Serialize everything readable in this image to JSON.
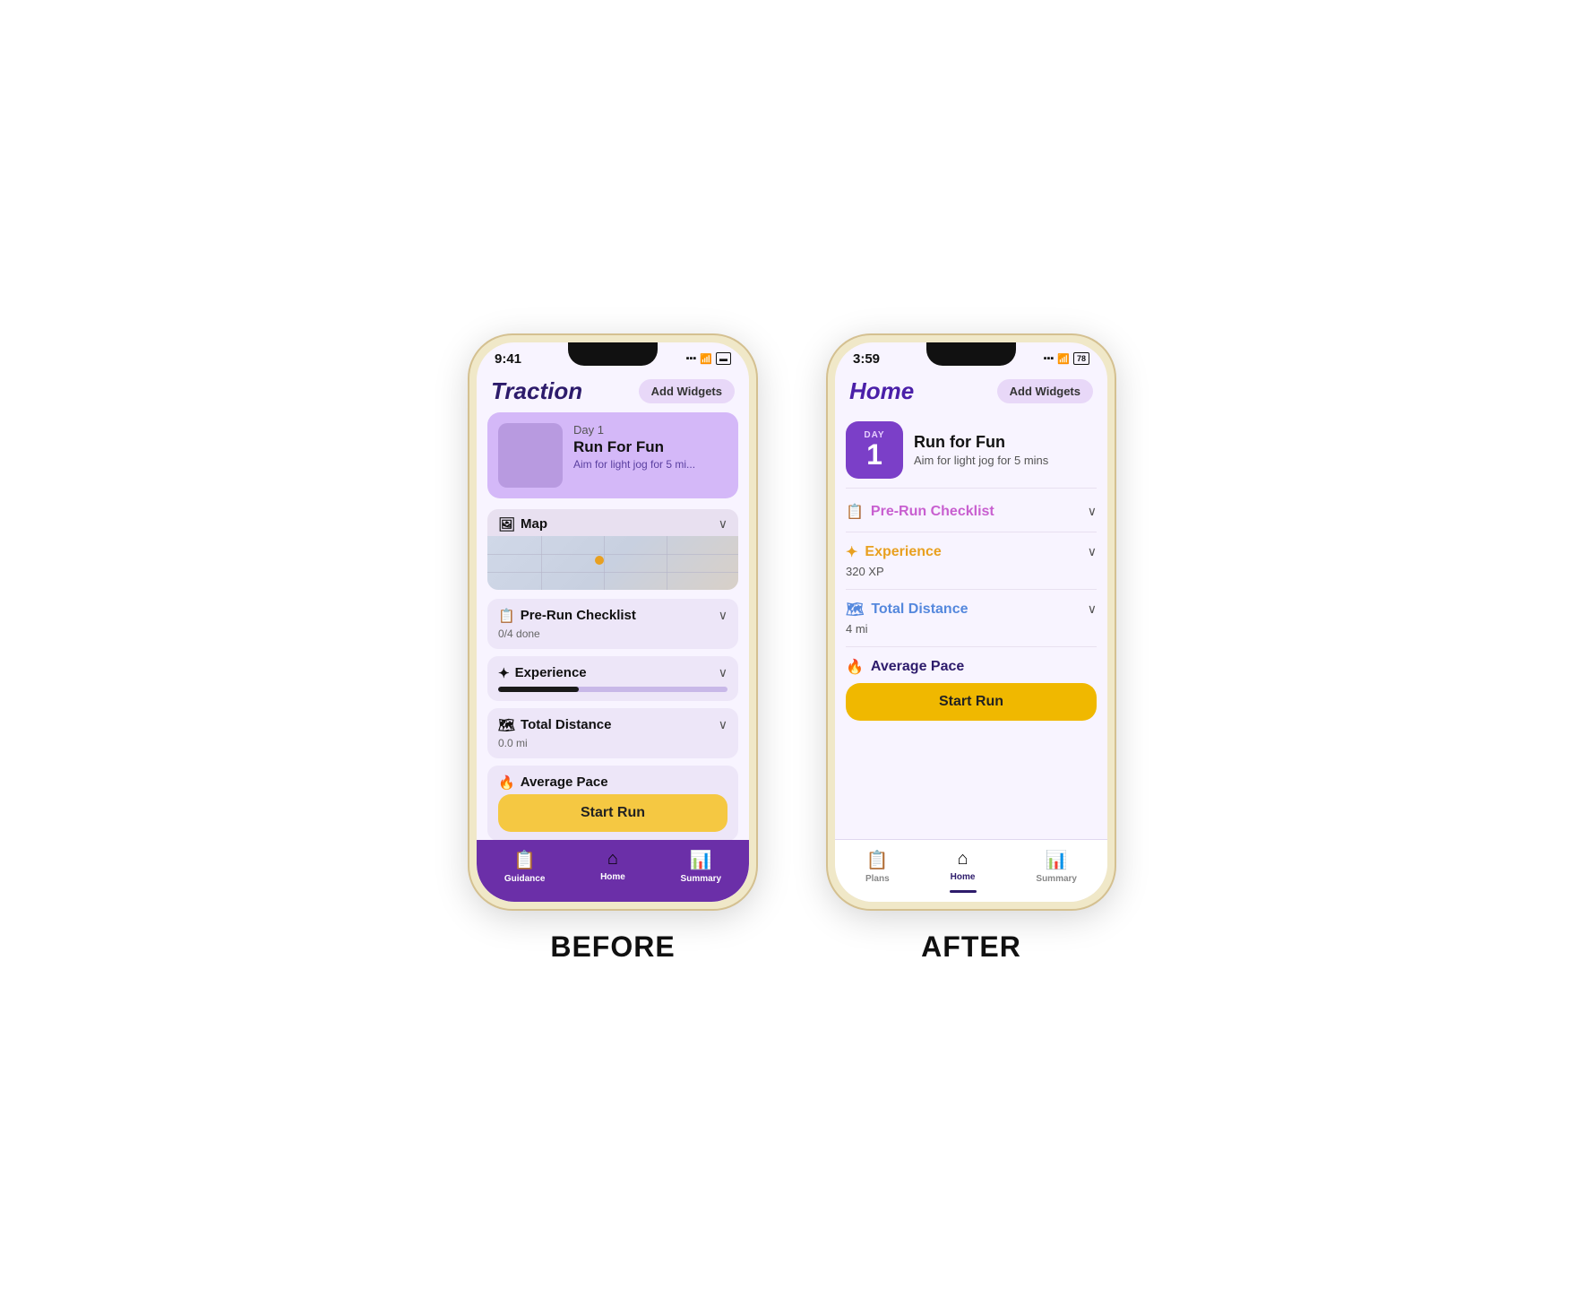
{
  "before": {
    "label": "BEFORE",
    "status_time": "9:41",
    "app_title": "Traction",
    "add_widgets": "Add Widgets",
    "day_label": "Day 1",
    "day_title": "Run For Fun",
    "day_desc": "Aim for light jog for 5 mi...",
    "map_title": "Map",
    "checklist_title": "Pre-Run Checklist",
    "checklist_sub": "0/4 done",
    "experience_title": "Experience",
    "distance_title": "Total Distance",
    "distance_sub": "0.0 mi",
    "pace_title": "Average Pace",
    "start_run": "Start Run",
    "nav_guidance": "Guidance",
    "nav_home": "Home",
    "nav_summary": "Summary"
  },
  "after": {
    "label": "AFTER",
    "status_time": "3:59",
    "battery": "78",
    "app_title": "Home",
    "add_widgets": "Add Widgets",
    "day_label": "DAY",
    "day_number": "1",
    "day_title": "Run for Fun",
    "day_desc": "Aim for light jog for 5 mins",
    "checklist_title": "Pre-Run Checklist",
    "experience_title": "Experience",
    "experience_sub": "320 XP",
    "distance_title": "Total Distance",
    "distance_sub": "4 mi",
    "pace_title": "Average Pace",
    "start_run": "Start Run",
    "nav_plans": "Plans",
    "nav_home": "Home",
    "nav_summary": "Summary"
  },
  "colors": {
    "purple_dark": "#2d1b6b",
    "purple_mid": "#7b3fc8",
    "purple_light": "#d4b8f8",
    "nav_bg": "#6b2fa8",
    "yellow": "#f5c842",
    "white": "#ffffff"
  }
}
